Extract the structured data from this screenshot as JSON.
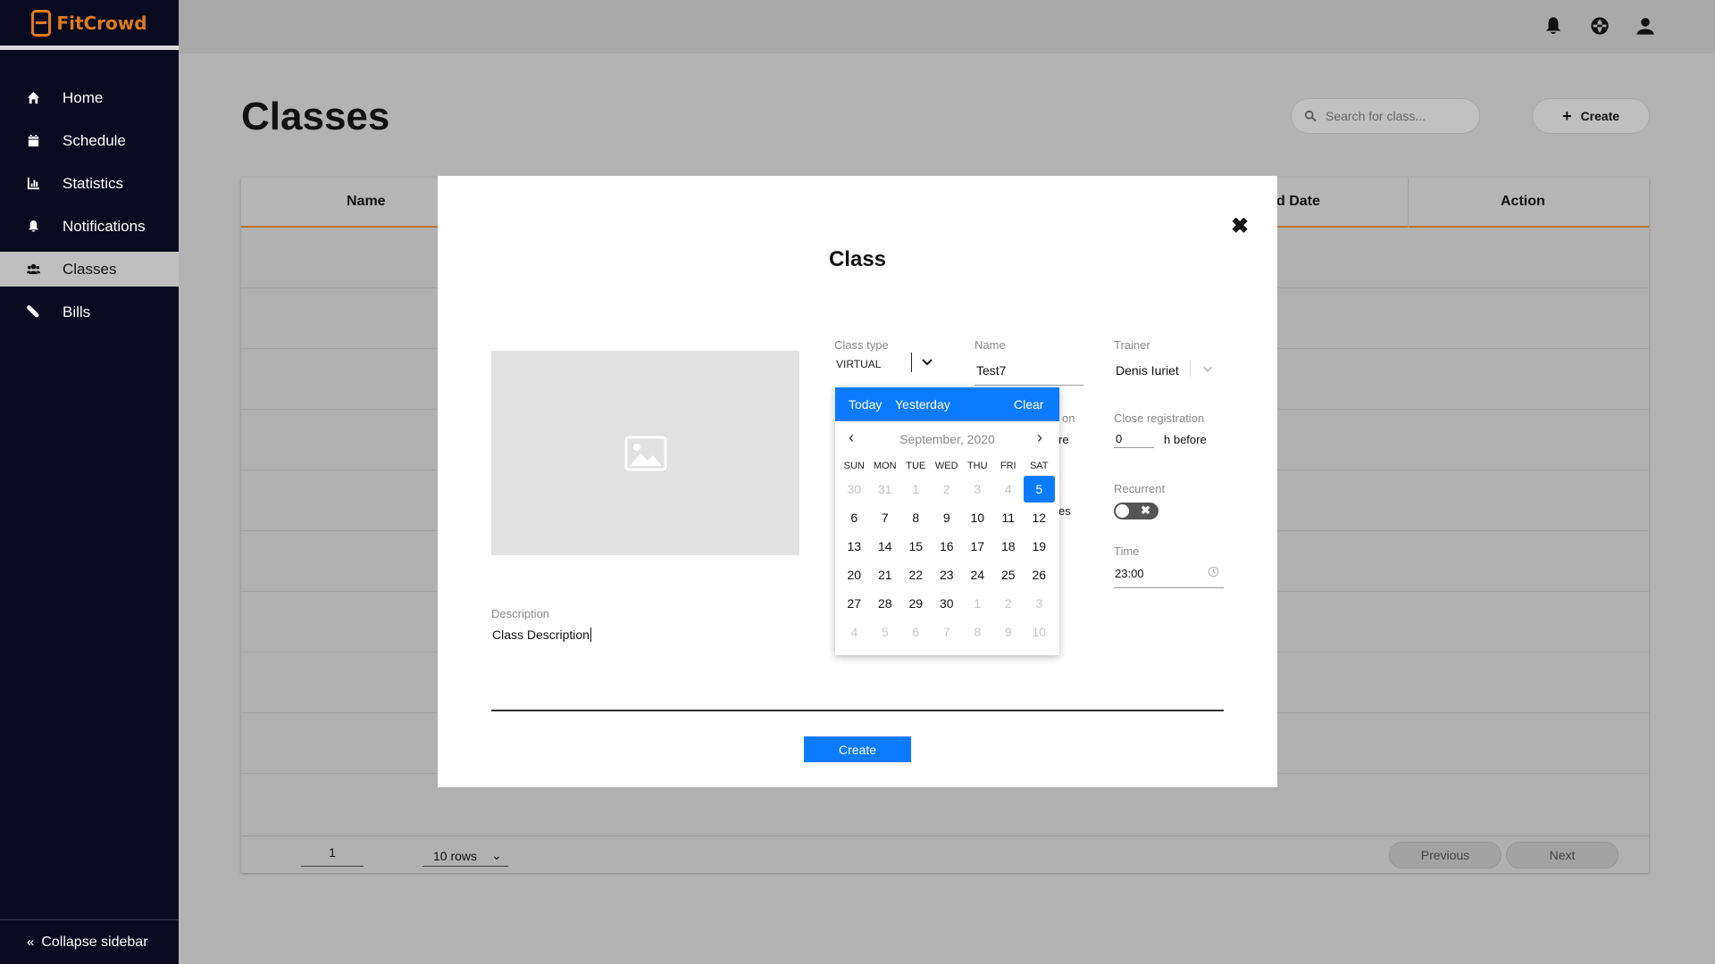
{
  "app": {
    "brand": "FitCrowd"
  },
  "sidebar": {
    "items": [
      {
        "label": "Home",
        "icon": "home-icon"
      },
      {
        "label": "Schedule",
        "icon": "calendar-icon"
      },
      {
        "label": "Statistics",
        "icon": "chart-icon"
      },
      {
        "label": "Notifications",
        "icon": "bell-icon"
      },
      {
        "label": "Classes",
        "icon": "users-icon",
        "active": true
      },
      {
        "label": "Bills",
        "icon": "pill-icon"
      }
    ],
    "collapse_label": "Collapse sidebar"
  },
  "page": {
    "title": "Classes",
    "search_placeholder": "Search for class...",
    "create_label": "Create"
  },
  "table": {
    "headers": [
      "Name",
      "d Date",
      "Action"
    ],
    "pagination": {
      "page": "1",
      "rows_label": "10 rows",
      "previous": "Previous",
      "next": "Next"
    }
  },
  "modal": {
    "title": "Class",
    "description_label": "Description",
    "description_value": "Class Description",
    "create_label": "Create",
    "fields": {
      "class_type_label": "Class type",
      "class_type_value": "VIRTUAL",
      "name_label": "Name",
      "name_value": "Test7",
      "trainer_label": "Trainer",
      "trainer_value": "Denis Iuriet",
      "close_registration_label": "Close registration",
      "close_registration_value": "0",
      "close_registration_suffix": "h before",
      "recurrent_label": "Recurrent",
      "time_label": "Time",
      "time_value": "23:00",
      "partial_text_1": "on",
      "partial_text_2": "re",
      "partial_text_3": "es"
    }
  },
  "calendar": {
    "quick": {
      "today": "Today",
      "yesterday": "Yesterday",
      "clear": "Clear"
    },
    "month_label": "September, 2020",
    "weekdays": [
      "SUN",
      "MON",
      "TUE",
      "WED",
      "THU",
      "FRI",
      "SAT"
    ],
    "days": [
      {
        "d": "30",
        "m": true
      },
      {
        "d": "31",
        "m": true
      },
      {
        "d": "1",
        "m": true
      },
      {
        "d": "2",
        "m": true
      },
      {
        "d": "3",
        "m": true
      },
      {
        "d": "4",
        "m": true
      },
      {
        "d": "5",
        "sel": true
      },
      {
        "d": "6"
      },
      {
        "d": "7"
      },
      {
        "d": "8"
      },
      {
        "d": "9"
      },
      {
        "d": "10"
      },
      {
        "d": "11"
      },
      {
        "d": "12"
      },
      {
        "d": "13"
      },
      {
        "d": "14"
      },
      {
        "d": "15"
      },
      {
        "d": "16"
      },
      {
        "d": "17"
      },
      {
        "d": "18"
      },
      {
        "d": "19"
      },
      {
        "d": "20"
      },
      {
        "d": "21"
      },
      {
        "d": "22"
      },
      {
        "d": "23"
      },
      {
        "d": "24"
      },
      {
        "d": "25"
      },
      {
        "d": "26"
      },
      {
        "d": "27"
      },
      {
        "d": "28"
      },
      {
        "d": "29"
      },
      {
        "d": "30"
      },
      {
        "d": "1",
        "m": true
      },
      {
        "d": "2",
        "m": true
      },
      {
        "d": "3",
        "m": true
      },
      {
        "d": "4",
        "m": true
      },
      {
        "d": "5",
        "m": true
      },
      {
        "d": "6",
        "m": true
      },
      {
        "d": "7",
        "m": true
      },
      {
        "d": "8",
        "m": true
      },
      {
        "d": "9",
        "m": true
      },
      {
        "d": "10",
        "m": true
      }
    ]
  },
  "colors": {
    "accent": "#0a7bff",
    "brand": "#e07b1a",
    "sidebar_bg": "#0a0a1e"
  }
}
